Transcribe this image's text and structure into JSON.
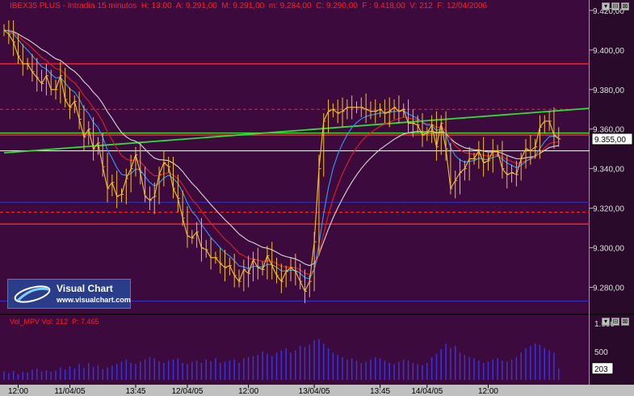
{
  "header": {
    "text": "IBEX35 PLUS - Intradía 15 minutos  H: 13:00  A: 9.291,00  M: 9.291,00  m: 9.284,00  C: 9.290,00  F : 9.418,00  V: 212  F: 12/04/2006"
  },
  "logo": {
    "brand": "Visual Chart",
    "url": "www.visualchart.com"
  },
  "subpanel": {
    "text": "Vol_MPV Vol: 212  P: 7.465"
  },
  "buttons": {
    "main": [
      "▾",
      "⊟",
      "⊠"
    ],
    "vol": [
      "▾",
      "⊟",
      "⊠"
    ]
  },
  "colors": {
    "background": "#3d0a3d",
    "price": "#f2c230",
    "volume": "#3a33dd",
    "red_line": "#ff2020",
    "green_line": "#33dd33",
    "blue_ma": "#3399ff",
    "red_ma": "#e02020",
    "white_ma": "#d8d8d8"
  },
  "chart_data": [
    {
      "type": "line",
      "title": "IBEX35 PLUS - Intradía 15 minutos",
      "ylim": [
        9270,
        9422
      ],
      "y_ticks": [
        "9.280,00",
        "9.300,00",
        "9.320,00",
        "9.340,00",
        "9.360,00",
        "9.380,00",
        "9.400,00",
        "9.420,00"
      ],
      "y_tick_values": [
        9280,
        9300,
        9320,
        9340,
        9360,
        9380,
        9400,
        9420
      ],
      "x_ticks": [
        "12:00",
        "11/04/05",
        "13:45",
        "12/04/05",
        "12:00",
        "13/04/05",
        "13:45",
        "14/04/05",
        "12:00"
      ],
      "x_tick_bars": [
        3,
        14,
        28,
        39,
        52,
        66,
        80,
        90,
        103
      ],
      "last_price_label": "9.355,00",
      "last_price": 9355,
      "n_bars": 119,
      "series": [
        {
          "name": "Close",
          "values": [
            9410,
            9408,
            9404,
            9397,
            9393,
            9393,
            9389,
            9386,
            9383,
            9387,
            9380,
            9380,
            9387,
            9375,
            9371,
            9374,
            9365,
            9356,
            9360,
            9350,
            9353,
            9341,
            9330,
            9333,
            9326,
            9327,
            9335,
            9340,
            9347,
            9338,
            9326,
            9324,
            9326,
            9337,
            9343,
            9341,
            9330,
            9325,
            9315,
            9306,
            9305,
            9308,
            9300,
            9299,
            9295,
            9295,
            9292,
            9290,
            9291,
            9286,
            9283,
            9289,
            9287,
            9294,
            9290,
            9289,
            9296,
            9291,
            9286,
            9283,
            9288,
            9290,
            9288,
            9283,
            9278,
            9283,
            9303,
            9340,
            9364,
            9369,
            9370,
            9368,
            9369,
            9371,
            9371,
            9371,
            9371,
            9370,
            9369,
            9369,
            9370,
            9368,
            9369,
            9371,
            9369,
            9370,
            9363,
            9363,
            9362,
            9357,
            9358,
            9362,
            9351,
            9363,
            9350,
            9330,
            9334,
            9338,
            9340,
            9345,
            9345,
            9349,
            9343,
            9344,
            9349,
            9349,
            9340,
            9337,
            9338,
            9337,
            9345,
            9350,
            9349,
            9351,
            9361,
            9364,
            9364,
            9357,
            9355
          ]
        },
        {
          "name": "Volume",
          "ylim": [
            0,
            1000
          ],
          "y_ticks": [
            "500",
            "1.000"
          ],
          "last_value_label": "203",
          "values": [
            150,
            120,
            160,
            100,
            140,
            130,
            180,
            200,
            150,
            170,
            140,
            160,
            220,
            180,
            240,
            200,
            280,
            210,
            300,
            230,
            260,
            190,
            220,
            250,
            280,
            320,
            360,
            300,
            280,
            320,
            360,
            400,
            380,
            330,
            300,
            340,
            360,
            380,
            300,
            280,
            320,
            340,
            300,
            360,
            330,
            380,
            300,
            320,
            340,
            360,
            300,
            380,
            400,
            420,
            440,
            500,
            460,
            420,
            480,
            520,
            560,
            480,
            520,
            600,
            580,
            620,
            700,
            720,
            640,
            560,
            480,
            440,
            400,
            360,
            380,
            340,
            300,
            320,
            360,
            400,
            380,
            340,
            300,
            280,
            320,
            360,
            340,
            300,
            280,
            260,
            300,
            400,
            460,
            540,
            640,
            560,
            600,
            480,
            440,
            400,
            380,
            340,
            300,
            320,
            360,
            380,
            340,
            320,
            360,
            400,
            480,
            560,
            600,
            640,
            620,
            560,
            520,
            480,
            203
          ]
        }
      ]
    }
  ]
}
